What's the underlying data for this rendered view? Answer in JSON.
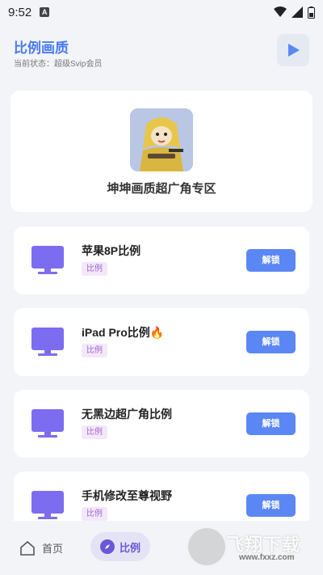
{
  "status_bar": {
    "time": "9:52",
    "notification_badge": "A"
  },
  "header": {
    "title": "比例画质",
    "subtitle": "当前状态：超级Svip会员"
  },
  "hero": {
    "title": "坤坤画质超广角专区"
  },
  "items": [
    {
      "name": "苹果8P比例",
      "tag": "比例",
      "button": "解锁"
    },
    {
      "name": "iPad Pro比例🔥",
      "tag": "比例",
      "button": "解锁"
    },
    {
      "name": "无黑边超广角比例",
      "tag": "比例",
      "button": "解锁"
    },
    {
      "name": "手机修改至尊视野",
      "tag": "比例",
      "button": "解锁"
    }
  ],
  "bottom_nav": {
    "home": "首页",
    "ratio": "比例"
  },
  "watermark": {
    "logo_text": "飞翔下载",
    "url": "www.fxxz.com"
  },
  "colors": {
    "accent": "#4a7bf5",
    "button": "#5b87f4",
    "tag_bg": "#f3e8fb",
    "tag_text": "#a266c9",
    "icon": "#7c6cf0"
  }
}
